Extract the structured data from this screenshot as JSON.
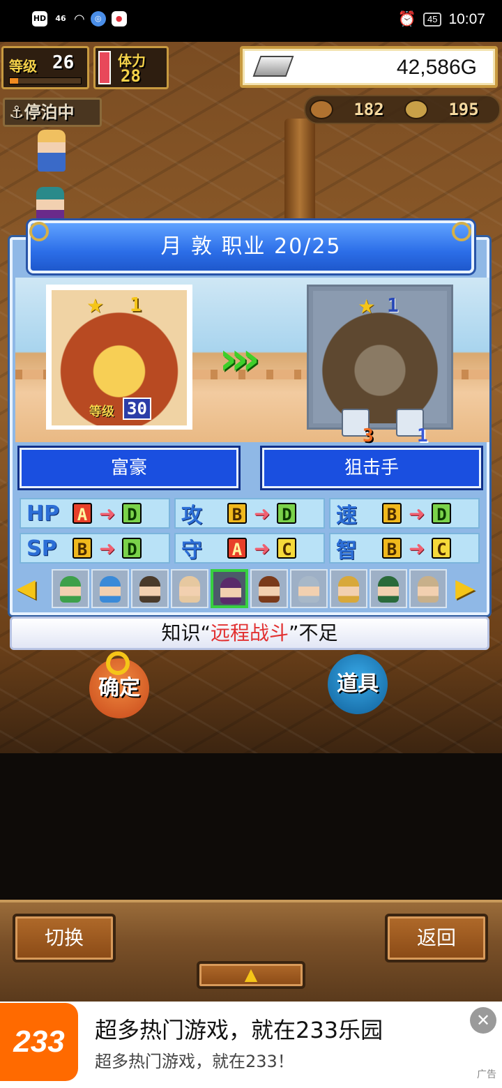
{
  "status_bar": {
    "left_chips": [
      "HD",
      "46",
      "wifi-icon",
      "browser-icon",
      "app-icon"
    ],
    "time": "10:07",
    "battery": "45"
  },
  "hud": {
    "level_label": "等级",
    "level_value": "26",
    "level_progress": 0.12,
    "stamina_label": "体力",
    "stamina_value": "28",
    "gold": "42,586G",
    "status": "停泊中",
    "resource_1": "182",
    "resource_2": "195"
  },
  "dialog": {
    "title": "月 敦  职业 20/25",
    "from_card": {
      "star_count": "1",
      "level_label": "等级",
      "level_value": "30"
    },
    "to_card": {
      "star_count": "1",
      "items": [
        {
          "icon": "spyglass-icon",
          "count": "3"
        },
        {
          "icon": "anchor-icon",
          "count": "1"
        }
      ]
    },
    "from_job": "富豪",
    "to_job": "狙击手",
    "stats": [
      {
        "name": "HP",
        "from": "A",
        "to": "D"
      },
      {
        "name": "攻",
        "from": "B",
        "to": "D"
      },
      {
        "name": "速",
        "from": "B",
        "to": "D"
      },
      {
        "name": "SP",
        "from": "B",
        "to": "D"
      },
      {
        "name": "守",
        "from": "A",
        "to": "C"
      },
      {
        "name": "智",
        "from": "B",
        "to": "C"
      }
    ],
    "roster": [
      {
        "color": "#3da04a"
      },
      {
        "color": "#3a8ad8"
      },
      {
        "color": "#4a3a2a"
      },
      {
        "color": "#e6c8a0"
      },
      {
        "color": "#5a2a6a",
        "selected": true
      },
      {
        "color": "#7a3a1a"
      },
      {
        "color": "#a8b8c8"
      },
      {
        "color": "#d8a83a"
      },
      {
        "color": "#2a6a3a"
      },
      {
        "color": "#c8b08a"
      }
    ],
    "message_prefix": "知识“",
    "message_highlight": "远程战斗",
    "message_suffix": "”不足"
  },
  "actions": {
    "confirm": "确定",
    "items": "道具",
    "switch": "切换",
    "back": "返回",
    "up": "▲"
  },
  "ad": {
    "logo": "233",
    "title": "超多热门游戏，就在233乐园",
    "subtitle": "超多热门游戏，就在233！",
    "tag": "广告",
    "close": "✕"
  }
}
